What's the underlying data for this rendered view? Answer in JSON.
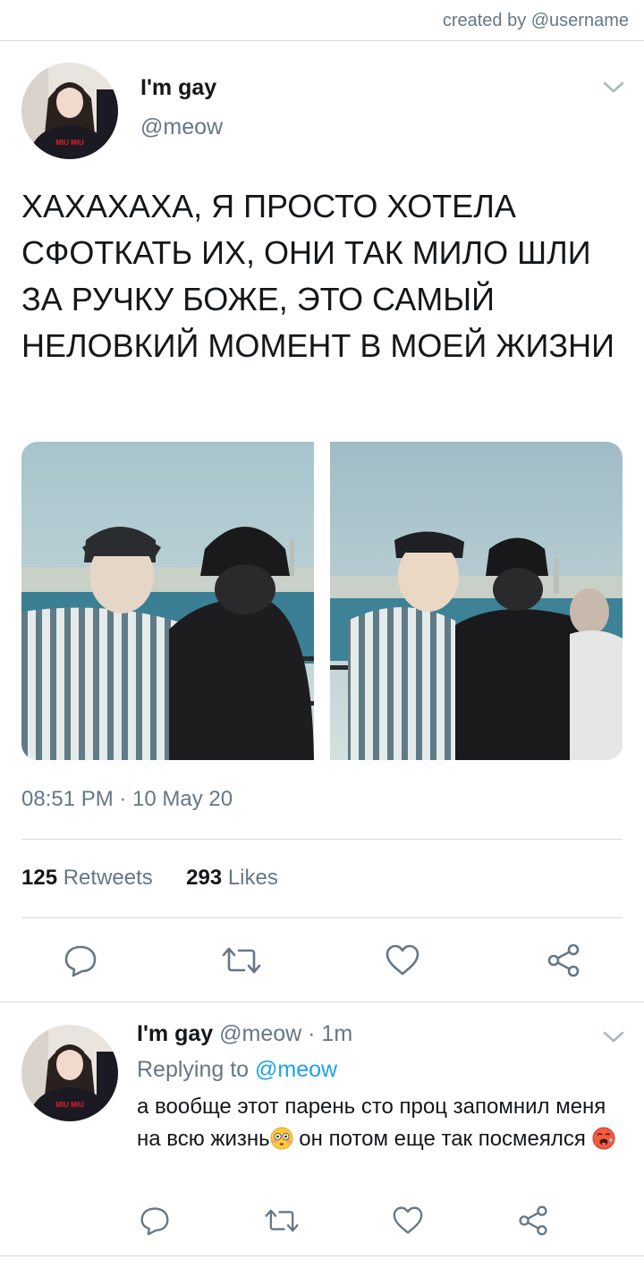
{
  "header": {
    "created_by": "created by @username"
  },
  "tweet": {
    "author_name": "I'm gay",
    "author_handle": "@meow",
    "text": "ХАХАХАХА, Я ПРОСТО ХОТЕЛА СФОТКАТЬ ИХ, ОНИ ТАК МИЛО ШЛИ ЗА РУЧКУ БОЖЕ, ЭТО САМЫЙ НЕЛОВКИЙ МОМЕНТ В МОЕЙ ЖИЗНИ",
    "timestamp": "08:51 PM · 10 May 20",
    "retweets_count": "125",
    "retweets_label": "Retweets",
    "likes_count": "293",
    "likes_label": "Likes",
    "avatar_shirt_text": "MIU MIU"
  },
  "reply": {
    "author_name": "I'm gay",
    "author_handle": "@meow",
    "time": "· 1m",
    "replying_prefix": "Replying to",
    "replying_mention": "@meow",
    "text_part1": "а вообще этот парень сто проц запомнил меня на всю жизнь",
    "text_part2": " он потом еще так посмеялся "
  },
  "icons": {
    "reply": "reply-bubble-icon",
    "retweet": "retweet-icon",
    "like": "heart-icon",
    "share": "share-icon",
    "more": "chevron-down-icon",
    "emoji1": "flushed-face-emoji",
    "emoji2": "hot-face-emoji"
  },
  "colors": {
    "text_primary": "#14171a",
    "text_secondary": "#657786",
    "link_blue": "#1da1f2",
    "divider": "#d7dce0"
  }
}
